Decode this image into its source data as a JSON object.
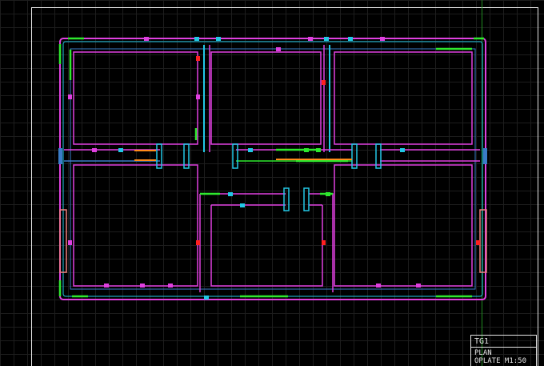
{
  "title_block": {
    "code": "TG1",
    "sheet": "PLAN",
    "detail": "OPLATE M1:50"
  },
  "colors": {
    "background": "#000000",
    "grid": "#1d1d1d",
    "frame": "#e6e6e6",
    "crosshair": "#1f8a1f",
    "magenta": "#e040e0",
    "cyan": "#22c8e6",
    "green": "#2ee82e",
    "blue": "#3a7cc8",
    "orange": "#ff8c1a",
    "salmon": "#f08080",
    "red": "#ff2020"
  }
}
